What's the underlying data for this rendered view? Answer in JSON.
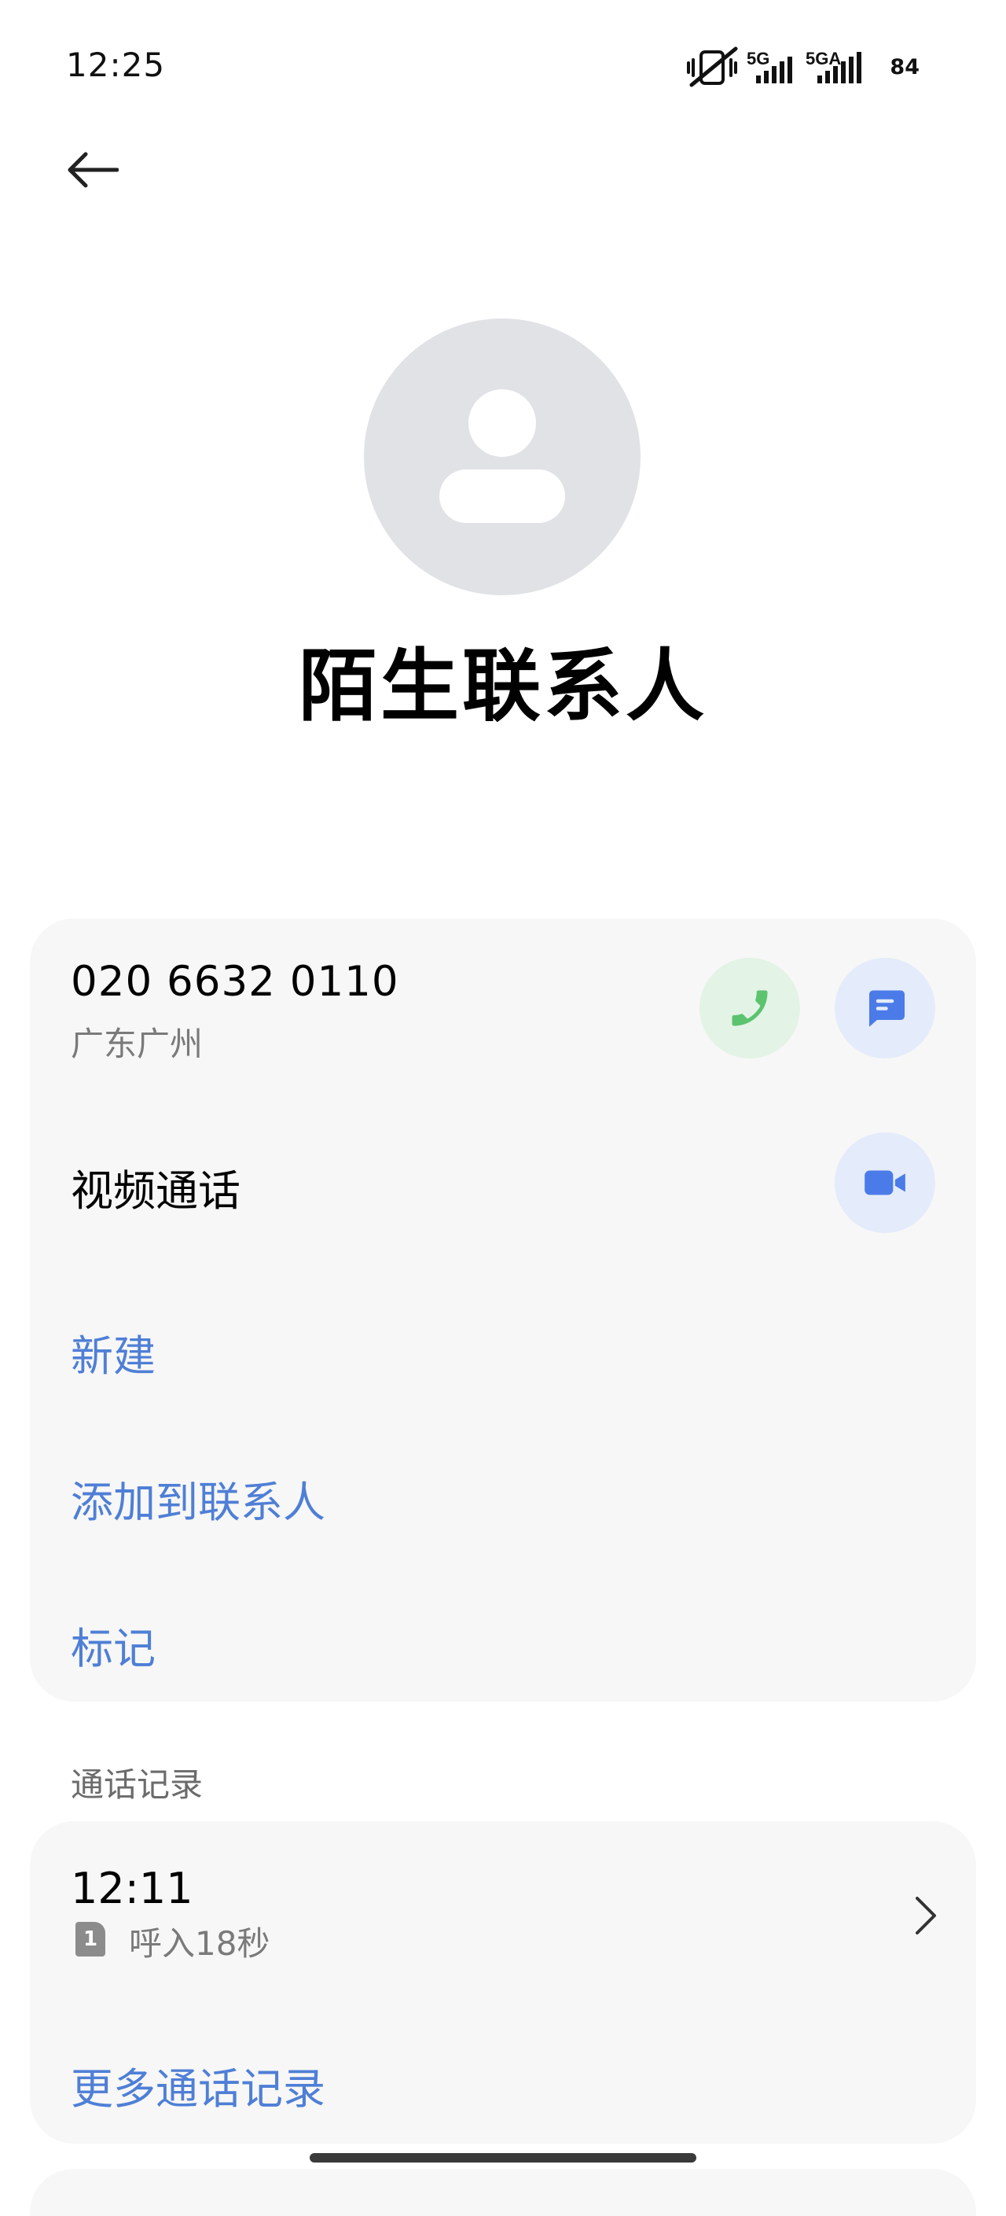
{
  "status_bar": {
    "time": "12:25",
    "network_1": "5G",
    "network_2": "5GA",
    "battery": "84",
    "icons": [
      "vibrate-mute-icon",
      "signal-icon",
      "signal-icon",
      "battery-icon"
    ]
  },
  "contact": {
    "name": "陌生联系人",
    "phone_number": "020 6632 0110",
    "location": "广东广州"
  },
  "actions": {
    "video_call_label": "视频通话",
    "new_label": "新建",
    "add_to_contacts_label": "添加到联系人",
    "mark_label": "标记"
  },
  "call_log": {
    "section_title": "通话记录",
    "entries": [
      {
        "time": "12:11",
        "sim": "1",
        "detail": "呼入18秒"
      }
    ],
    "more_label": "更多通话记录"
  },
  "colors": {
    "link_blue": "#4f7fd6",
    "call_green": "#5cc36f",
    "icon_blue": "#4a7be8",
    "card_bg": "#f7f7f7"
  }
}
